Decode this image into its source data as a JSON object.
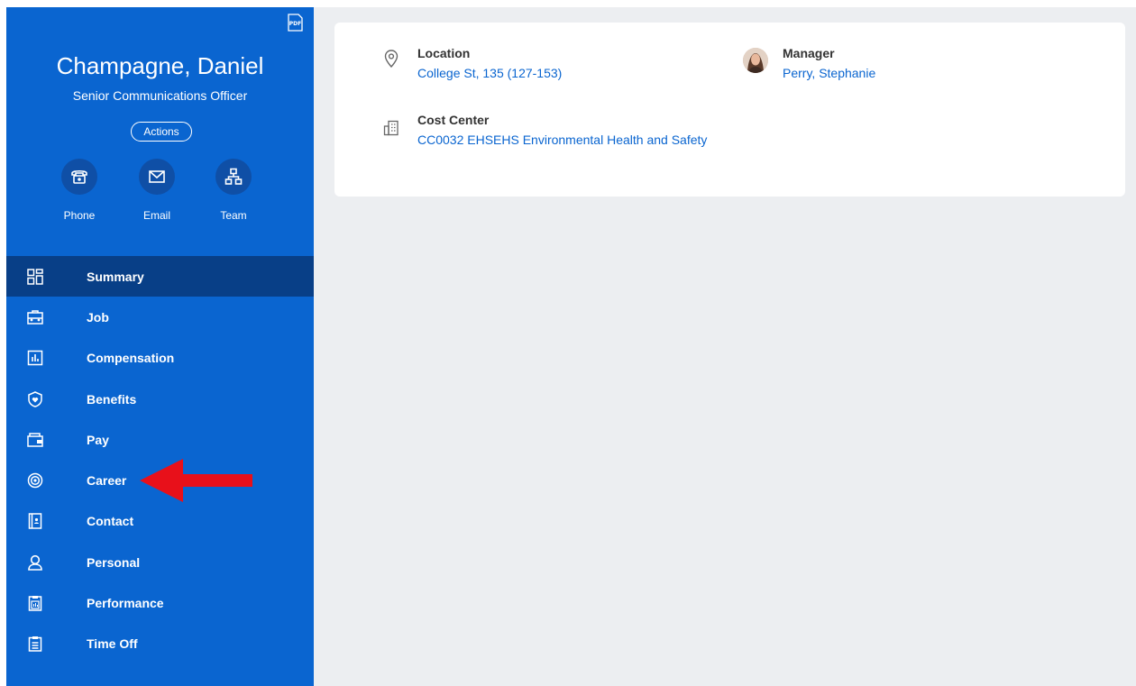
{
  "profile": {
    "name": "Champagne, Daniel",
    "title": "Senior Communications Officer",
    "actions_label": "Actions",
    "pdf_icon": "pdf-icon"
  },
  "quick_actions": [
    {
      "label": "Phone",
      "icon": "phone-icon"
    },
    {
      "label": "Email",
      "icon": "email-icon"
    },
    {
      "label": "Team",
      "icon": "team-icon"
    }
  ],
  "nav": {
    "items": [
      {
        "label": "Summary",
        "icon": "summary-grid-icon",
        "active": true
      },
      {
        "label": "Job",
        "icon": "briefcase-icon"
      },
      {
        "label": "Compensation",
        "icon": "chart-icon"
      },
      {
        "label": "Benefits",
        "icon": "shield-heart-icon"
      },
      {
        "label": "Pay",
        "icon": "wallet-icon"
      },
      {
        "label": "Career",
        "icon": "target-icon"
      },
      {
        "label": "Contact",
        "icon": "contact-book-icon"
      },
      {
        "label": "Personal",
        "icon": "person-icon"
      },
      {
        "label": "Performance",
        "icon": "clipboard-chart-icon"
      },
      {
        "label": "Time Off",
        "icon": "clipboard-icon"
      }
    ]
  },
  "summary": {
    "location": {
      "label": "Location",
      "value": "College St, 135 (127-153)",
      "icon": "location-pin-icon"
    },
    "manager": {
      "label": "Manager",
      "value": "Perry, Stephanie",
      "avatar": "manager-avatar"
    },
    "cost_center": {
      "label": "Cost Center",
      "value": "CC0032 EHSEHS Environmental Health and Safety",
      "icon": "building-icon"
    }
  },
  "annotation": {
    "type": "red-arrow",
    "target": "Career",
    "color": "#e8101a"
  },
  "colors": {
    "sidebar": "#0a65d0",
    "sidebar_active": "#083f87",
    "quick_circle": "#0f4fa6",
    "link": "#0a65d0",
    "main_bg": "#eceef1"
  }
}
